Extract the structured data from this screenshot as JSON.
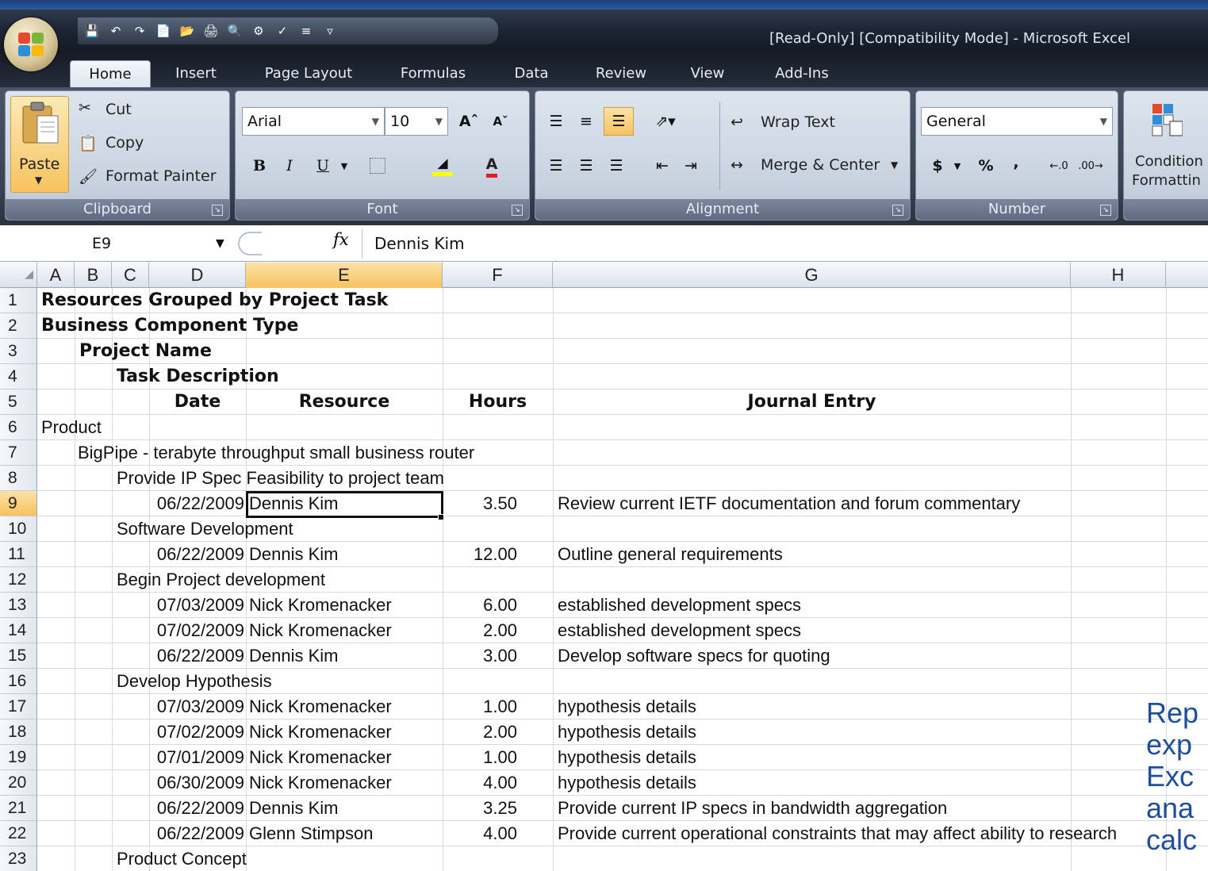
{
  "window": {
    "title": "[Read-Only]  [Compatibility Mode] - Microsoft Excel"
  },
  "tabs": [
    "Home",
    "Insert",
    "Page Layout",
    "Formulas",
    "Data",
    "Review",
    "View",
    "Add-Ins"
  ],
  "ribbon": {
    "clipboard": {
      "paste": "Paste",
      "cut": "Cut",
      "copy": "Copy",
      "format_painter": "Format Painter",
      "label": "Clipboard"
    },
    "font": {
      "name": "Arial",
      "size": "10",
      "label": "Font",
      "bold": "B",
      "italic": "I",
      "underline": "U"
    },
    "alignment": {
      "wrap_text": "Wrap Text",
      "merge_center": "Merge & Center",
      "label": "Alignment"
    },
    "number": {
      "format": "General",
      "currency": "$",
      "percent": "%",
      "comma": ",",
      "label": "Number"
    },
    "styles": {
      "conditional_line1": "Condition",
      "conditional_line2": "Formattin"
    }
  },
  "formula_bar": {
    "name_box": "E9",
    "fx": "fx",
    "value": "Dennis Kim"
  },
  "columns": [
    "A",
    "B",
    "C",
    "D",
    "E",
    "F",
    "G",
    "H"
  ],
  "rows": [
    "1",
    "2",
    "3",
    "4",
    "5",
    "6",
    "7",
    "8",
    "9",
    "10",
    "11",
    "12",
    "13",
    "14",
    "15",
    "16",
    "17",
    "18",
    "19",
    "20",
    "21",
    "22",
    "23"
  ],
  "headings": {
    "r1": "Resources Grouped by Project Task",
    "r2": "Business Component Type",
    "r3": "Project Name",
    "r4": "Task Description",
    "date": "Date",
    "resource": "Resource",
    "hours": "Hours",
    "journal": "Journal Entry"
  },
  "body": {
    "r6": "Product",
    "r7": "BigPipe - terabyte throughput small business router",
    "r8": "Provide IP Spec Feasibility to project team",
    "r10": "Software Development",
    "r12": "Begin Project development",
    "r16": "Develop Hypothesis",
    "r23": "Product Concept"
  },
  "entries": [
    {
      "row": "9",
      "date": "06/22/2009",
      "resource": "Dennis Kim",
      "hours": "3.50",
      "journal": "Review current IETF documentation and forum commentary"
    },
    {
      "row": "11",
      "date": "06/22/2009",
      "resource": "Dennis Kim",
      "hours": "12.00",
      "journal": "Outline general requirements"
    },
    {
      "row": "13",
      "date": "07/03/2009",
      "resource": "Nick Kromenacker",
      "hours": "6.00",
      "journal": "established development specs"
    },
    {
      "row": "14",
      "date": "07/02/2009",
      "resource": "Nick Kromenacker",
      "hours": "2.00",
      "journal": "established development specs"
    },
    {
      "row": "15",
      "date": "06/22/2009",
      "resource": "Dennis Kim",
      "hours": "3.00",
      "journal": "Develop software specs for quoting"
    },
    {
      "row": "17",
      "date": "07/03/2009",
      "resource": "Nick Kromenacker",
      "hours": "1.00",
      "journal": "hypothesis details"
    },
    {
      "row": "18",
      "date": "07/02/2009",
      "resource": "Nick Kromenacker",
      "hours": "2.00",
      "journal": "hypothesis details"
    },
    {
      "row": "19",
      "date": "07/01/2009",
      "resource": "Nick Kromenacker",
      "hours": "1.00",
      "journal": "hypothesis details"
    },
    {
      "row": "20",
      "date": "06/30/2009",
      "resource": "Nick Kromenacker",
      "hours": "4.00",
      "journal": "hypothesis details"
    },
    {
      "row": "21",
      "date": "06/22/2009",
      "resource": "Dennis Kim",
      "hours": "3.25",
      "journal": "Provide current IP specs in bandwidth aggregation"
    },
    {
      "row": "22",
      "date": "06/22/2009",
      "resource": "Glenn Stimpson",
      "hours": "4.00",
      "journal": "Provide current operational constraints that may affect ability to research"
    }
  ],
  "overlay": [
    "Rep",
    "exp",
    "Exc",
    "ana",
    "calc"
  ],
  "colors": {
    "selection_header": "#f7c35f",
    "overlay_text": "#1f4e9e",
    "ribbon_group": "#c9d3e0"
  }
}
